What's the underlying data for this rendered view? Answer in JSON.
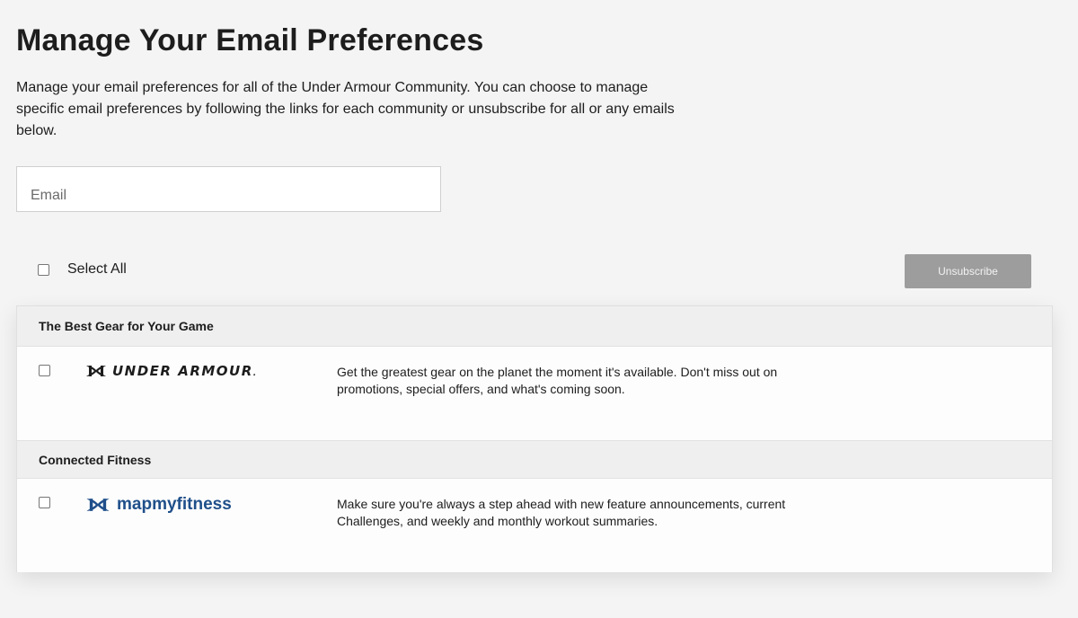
{
  "header": {
    "title": "Manage Your Email Preferences",
    "intro": "Manage your email preferences for all of the Under Armour Community. You can choose to manage specific email preferences by following the links for each community or unsubscribe for all or any emails below."
  },
  "email_field": {
    "placeholder": "Email",
    "value": ""
  },
  "controls": {
    "select_all_label": "Select All",
    "select_all_checked": false,
    "unsubscribe_label": "Unsubscribe"
  },
  "sections": [
    {
      "title": "The Best Gear for Your Game",
      "logo_text": "UNDER ARMOUR",
      "logo_icon": "under-armour-logo-icon",
      "description": "Get the greatest gear on the planet the moment it's available. Don't miss out on promotions, special offers, and what's coming soon.",
      "checked": false
    },
    {
      "title": "Connected Fitness",
      "logo_text": "mapmyfitness",
      "logo_icon": "under-armour-logo-icon",
      "description": "Make sure you're always a step ahead with new feature announcements, current Challenges, and weekly and monthly workout summaries.",
      "checked": false
    }
  ],
  "colors": {
    "background": "#f4f4f4",
    "button_disabled": "#9d9d9d",
    "mapmyfitness_blue": "#1f4f8a",
    "text": "#1d1d1d"
  }
}
